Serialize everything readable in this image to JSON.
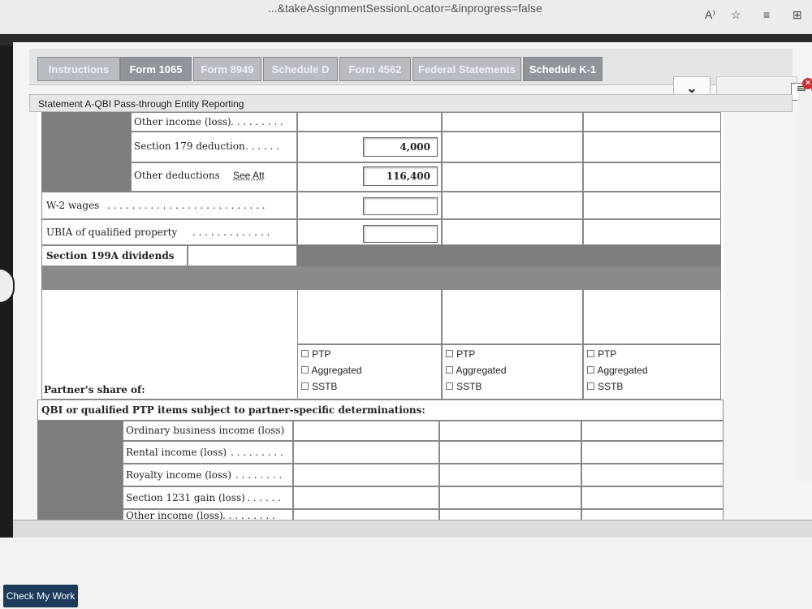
{
  "browser": {
    "url": "...&takeAssignmentSessionLocator=&inprogress=false"
  },
  "tabs": [
    {
      "label": "Instructions"
    },
    {
      "label": "Form 1065"
    },
    {
      "label": "Form 8949"
    },
    {
      "label": "Schedule D"
    },
    {
      "label": "Form 4562"
    },
    {
      "label": "Federal Statements"
    },
    {
      "label": "Schedule K-1"
    }
  ],
  "statement_title": "Statement A-QBI Pass-through Entity Reporting",
  "upper_rows": {
    "other_income": "Other income (loss)",
    "section179": "Section 179 deduction",
    "other_deductions": "Other deductions",
    "see_att": "See Att",
    "w2_wages": "W-2 wages",
    "ubia": "UBIA of qualified property",
    "section199a": "Section 199A dividends"
  },
  "values": {
    "section179": "4,000",
    "other_deductions": "116,400"
  },
  "checkboxes": {
    "ptp": "PTP",
    "aggregated": "Aggregated",
    "sstb": "SSTB"
  },
  "partner_share": "Partner's share of:",
  "qbi_heading": "QBI or qualified PTP items subject to partner-specific determinations:",
  "lower_rows": [
    {
      "label": "Ordinary business income (loss)"
    },
    {
      "label": "Rental income (loss)"
    },
    {
      "label": "Royalty income (loss)"
    },
    {
      "label": "Section 1231 gain (loss)"
    },
    {
      "label": "Other income (loss)"
    }
  ],
  "check_my_work": "Check My Work"
}
